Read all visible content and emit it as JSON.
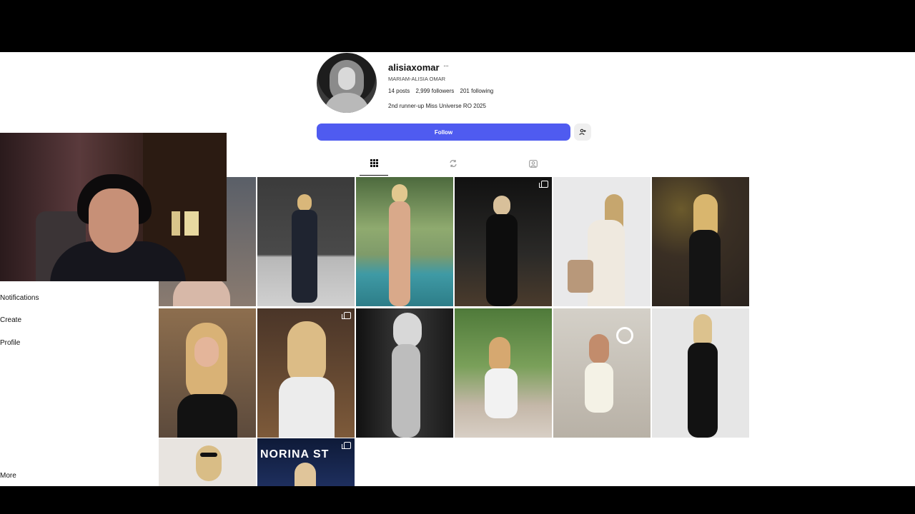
{
  "profile": {
    "username": "alisiaxomar",
    "more_icon": "ellipsis-icon",
    "full_name": "MARIAM-ALISIA OMAR",
    "posts": "14 posts",
    "followers": "2,999 followers",
    "following": "201 following",
    "bio": "2nd runner-up Miss Universe RO 2025"
  },
  "actions": {
    "follow_label": "Follow",
    "suggest_icon": "add-person-icon"
  },
  "tabs": [
    {
      "name": "posts",
      "icon": "grid-icon",
      "active": true
    },
    {
      "name": "reposts",
      "icon": "repost-icon",
      "active": false
    },
    {
      "name": "tagged",
      "icon": "tagged-icon",
      "active": false
    }
  ],
  "sidebar": {
    "items": [
      {
        "label": "Notifications"
      },
      {
        "label": "Create"
      },
      {
        "label": "Profile"
      },
      {
        "label": "More"
      }
    ]
  },
  "grid": {
    "posts": [
      {
        "id": "post-1",
        "multi": false,
        "caption": ""
      },
      {
        "id": "post-2",
        "multi": false,
        "caption": ""
      },
      {
        "id": "post-3",
        "multi": false,
        "caption": ""
      },
      {
        "id": "post-4",
        "multi": true,
        "caption": ""
      },
      {
        "id": "post-5",
        "multi": false,
        "caption": ""
      },
      {
        "id": "post-6",
        "multi": false,
        "caption": ""
      },
      {
        "id": "post-7",
        "multi": false,
        "caption": ""
      },
      {
        "id": "post-8",
        "multi": true,
        "caption": ""
      },
      {
        "id": "post-9",
        "multi": false,
        "caption": ""
      },
      {
        "id": "post-10",
        "multi": false,
        "caption": ""
      },
      {
        "id": "post-11",
        "multi": false,
        "caption": ""
      },
      {
        "id": "post-12",
        "multi": false,
        "caption": ""
      },
      {
        "id": "post-13",
        "multi": false,
        "caption": ""
      },
      {
        "id": "post-14",
        "multi": true,
        "caption": "NORINA ST"
      }
    ]
  },
  "colors": {
    "follow_button": "#4f5bf0",
    "background": "#ffffff",
    "letterbox": "#000000"
  }
}
